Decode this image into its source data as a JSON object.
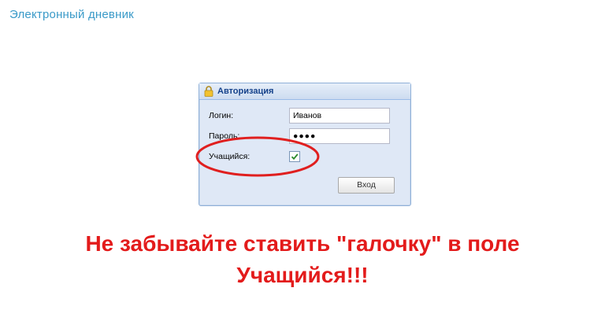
{
  "app": {
    "title": "Электронный дневник"
  },
  "auth": {
    "title": "Авторизация",
    "login_label": "Логин:",
    "login_value": "Иванов",
    "password_label": "Пароль:",
    "password_value": "●●●●",
    "student_label": "Учащийся:",
    "student_checked": true,
    "submit_label": "Вход"
  },
  "notice": {
    "line1": "Не забывайте ставить \"галочку\" в поле",
    "line2": "Учащийся!!!"
  },
  "colors": {
    "app_title": "#3a9ac8",
    "window_bg": "#dfe8f6",
    "header_text": "#15428b",
    "notice": "#e31b1b",
    "highlight": "#e01f1f"
  },
  "icons": {
    "header": "lock-icon",
    "checkbox": "checkmark-icon"
  }
}
